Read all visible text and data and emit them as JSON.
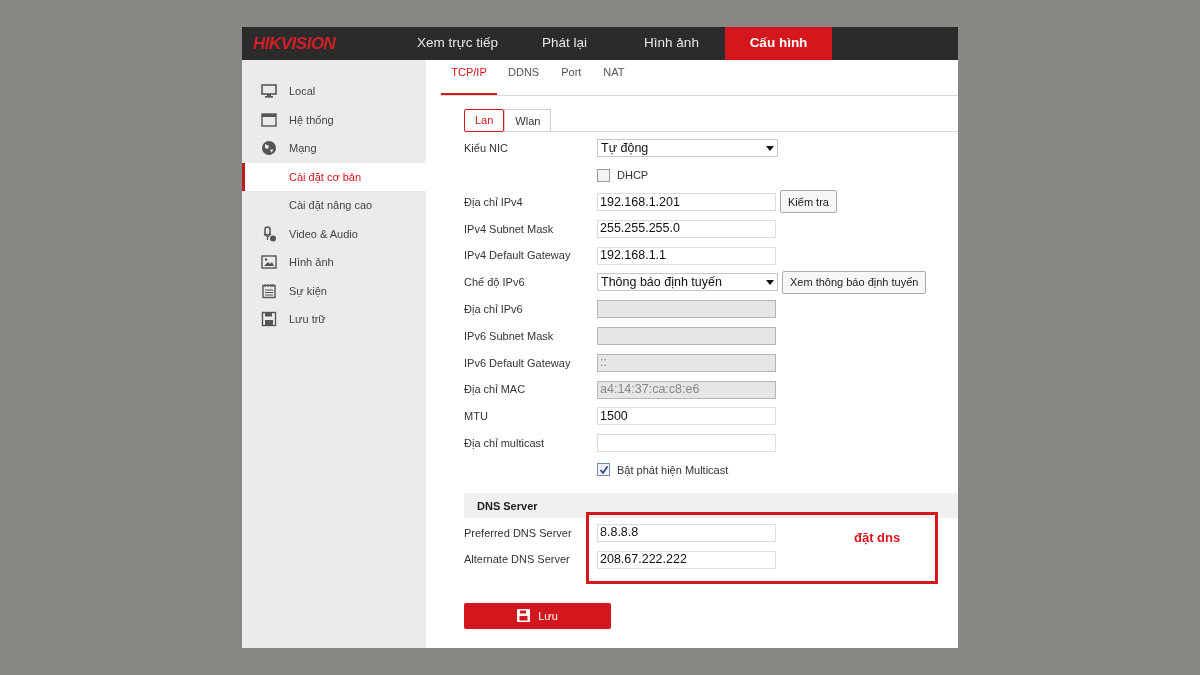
{
  "brand": {
    "logo": "HIKVISION"
  },
  "nav": [
    {
      "label": "Xem trực tiếp",
      "selected": false
    },
    {
      "label": "Phát lại",
      "selected": false
    },
    {
      "label": "Hình ảnh",
      "selected": false
    },
    {
      "label": "Cấu hình",
      "selected": true
    }
  ],
  "sidebar": {
    "items": [
      {
        "label": "Local",
        "selected": false
      },
      {
        "label": "Hệ thống",
        "selected": false
      },
      {
        "label": "Mạng",
        "selected": false,
        "children": [
          {
            "label": "Cài đặt cơ bản",
            "selected": true
          },
          {
            "label": "Cài đặt nâng cao",
            "selected": false
          }
        ]
      },
      {
        "label": "Video & Audio",
        "selected": false
      },
      {
        "label": "Hình ảnh",
        "selected": false
      },
      {
        "label": "Sự kiện",
        "selected": false
      },
      {
        "label": "Lưu trữ",
        "selected": false
      }
    ]
  },
  "tabs": [
    {
      "label": "TCP/IP",
      "selected": true
    },
    {
      "label": "DDNS",
      "selected": false
    },
    {
      "label": "Port",
      "selected": false
    },
    {
      "label": "NAT",
      "selected": false
    }
  ],
  "subtabs": [
    {
      "label": "Lan",
      "selected": true
    },
    {
      "label": "Wlan",
      "selected": false
    }
  ],
  "form": [
    {
      "kind": "select",
      "label": "Kiểu NIC",
      "value": "Tự động"
    },
    {
      "kind": "checkbox",
      "label": "DHCP",
      "checked": false
    },
    {
      "kind": "text",
      "label": "Địa chỉ IPv4",
      "value": "192.168.1.201",
      "disabled": false,
      "button": "Kiểm tra"
    },
    {
      "kind": "text",
      "label": "IPv4 Subnet Mask",
      "value": "255.255.255.0",
      "disabled": false
    },
    {
      "kind": "text",
      "label": "IPv4 Default Gateway",
      "value": "192.168.1.1",
      "disabled": false
    },
    {
      "kind": "select",
      "label": "Chế độ IPv6",
      "value": "Thông báo định tuyến",
      "button": "Xem thông báo định tuyến"
    },
    {
      "kind": "text",
      "label": "Địa chỉ IPv6",
      "disabled": true
    },
    {
      "kind": "text",
      "label": "IPv6 Subnet Mask",
      "disabled": true
    },
    {
      "kind": "text",
      "label": "IPv6 Default Gateway",
      "value": "::",
      "disabled": true
    },
    {
      "kind": "text",
      "label": "Địa chỉ MAC",
      "value": "a4:14:37:ca:c8:e6",
      "disabled": true
    },
    {
      "kind": "text",
      "label": "MTU",
      "value": "1500",
      "disabled": false
    },
    {
      "kind": "text",
      "label": "Địa chỉ multicast",
      "disabled": false
    },
    {
      "kind": "checkbox",
      "label": "Bật phát hiện Multicast",
      "checked": true
    }
  ],
  "dns": {
    "title": "DNS Server",
    "fields": [
      {
        "label": "Preferred DNS Server",
        "value": "8.8.8.8"
      },
      {
        "label": "Alternate DNS Server",
        "value": "208.67.222.222"
      }
    ],
    "annotation": "đặt dns"
  },
  "save_button": "Lưu"
}
